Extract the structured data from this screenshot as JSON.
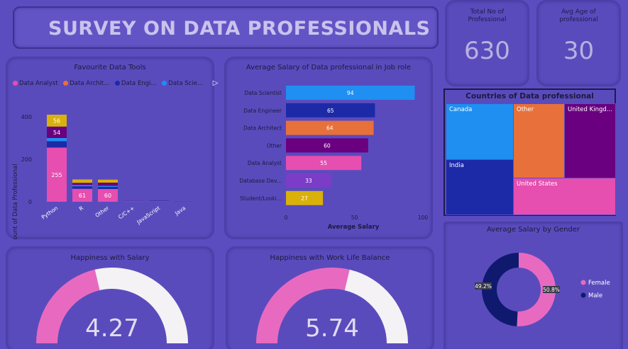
{
  "header": {
    "title": "SURVEY ON DATA PROFESSIONALS"
  },
  "kpis": [
    {
      "label": "Total No of Professional",
      "value": "630"
    },
    {
      "label": "Avg Age of professional",
      "value": "30"
    }
  ],
  "colors": {
    "data_analyst": "#e64eb0",
    "data_architect": "#e8703a",
    "data_engineer": "#1c2aa8",
    "data_scientist": "#1f8ff2",
    "other": "#6a0080",
    "yellow": "#d9b10a"
  },
  "chart_data": [
    {
      "type": "bar",
      "title": "Favourite Data Tools",
      "ylabel": "Count of Data Professional",
      "ylim": [
        0,
        450
      ],
      "yticks": [
        "0",
        "200",
        "400"
      ],
      "categories": [
        "Python",
        "R",
        "Other",
        "C/C++",
        "JavaScript",
        "Java"
      ],
      "legend": [
        "Data Analyst",
        "Data Archit...",
        "Data Engi...",
        "Data Scie..."
      ],
      "series": [
        {
          "name": "Data Analyst",
          "values": [
            255,
            61,
            60,
            2,
            2,
            1
          ]
        },
        {
          "name": "Data Architect",
          "values": [
            0,
            0,
            0,
            0,
            0,
            0
          ]
        },
        {
          "name": "Data Engineer",
          "values": [
            30,
            12,
            10,
            1,
            2,
            1
          ]
        },
        {
          "name": "Data Scientist",
          "values": [
            15,
            6,
            5,
            0,
            1,
            0
          ]
        },
        {
          "name": "Other",
          "values": [
            54,
            10,
            15,
            1,
            2,
            0
          ]
        },
        {
          "name": "",
          "values": [
            56,
            16,
            14,
            0,
            0,
            0
          ]
        }
      ],
      "data_labels": {
        "0-0": "255",
        "0-4": "54",
        "0-5": "56",
        "1-0": "61",
        "2-0": "60"
      }
    },
    {
      "type": "bar",
      "orientation": "horizontal",
      "title": "Average Salary of Data professional in Job role",
      "xlabel": "Average Salary",
      "xlim": [
        0,
        100
      ],
      "xticks": [
        "0",
        "50",
        "100"
      ],
      "categories": [
        "Data Scientist",
        "Data Engineer",
        "Data Architect",
        "Other",
        "Data Analyst",
        "Database Dev...",
        "Student/Looki..."
      ],
      "values": [
        94,
        65,
        64,
        60,
        55,
        33,
        27
      ],
      "colors": [
        "#1f8ff2",
        "#1c2aa8",
        "#e8703a",
        "#6a0080",
        "#e64eb0",
        "#7b3cc8",
        "#d9b10a"
      ]
    },
    {
      "type": "treemap",
      "title": "Countries of Data professional",
      "cells": [
        {
          "label": "Canada",
          "color": "#1f8ff2"
        },
        {
          "label": "Other",
          "color": "#e8703a"
        },
        {
          "label": "United Kingd...",
          "color": "#6a0080"
        },
        {
          "label": "India",
          "color": "#1c2aa8"
        },
        {
          "label": "United States",
          "color": "#e64eb0"
        }
      ]
    },
    {
      "type": "pie",
      "title": "Average Salary by Gender",
      "categories": [
        "Female",
        "Male"
      ],
      "values": [
        50.8,
        49.2
      ],
      "labels": [
        "50.8%",
        "49.2%"
      ],
      "colors": [
        "#e86ac0",
        "#0f1a6e"
      ]
    },
    {
      "type": "gauge",
      "title": "Happiness with Salary",
      "value": 4.27,
      "display": "4.27",
      "max": 10
    },
    {
      "type": "gauge",
      "title": "Happiness with Work Life Balance",
      "value": 5.74,
      "display": "5.74",
      "max": 10
    }
  ]
}
